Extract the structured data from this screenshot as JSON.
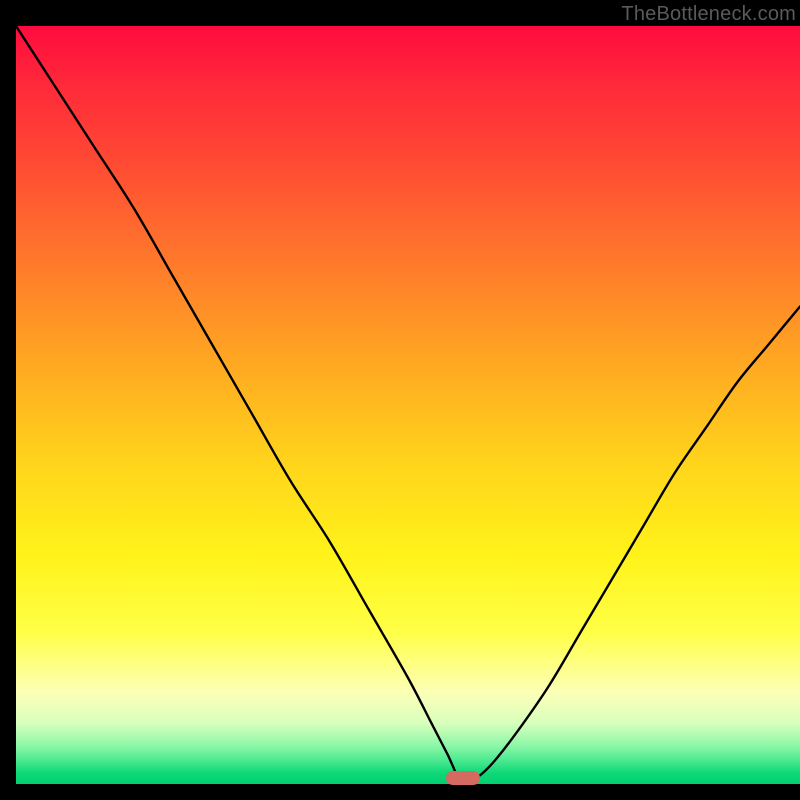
{
  "watermark": "TheBottleneck.com",
  "colors": {
    "frame": "#000000",
    "curve": "#000000",
    "marker": "#d46a60",
    "watermark": "#5a5a5a"
  },
  "chart_data": {
    "type": "line",
    "title": "",
    "xlabel": "",
    "ylabel": "",
    "xlim": [
      0,
      100
    ],
    "ylim": [
      0,
      100
    ],
    "grid": false,
    "legend": false,
    "annotations": [
      {
        "kind": "watermark",
        "text": "TheBottleneck.com",
        "position": "top-right"
      }
    ],
    "optimum": {
      "x": 57,
      "y": 0
    },
    "series": [
      {
        "name": "bottleneck-curve",
        "x": [
          0,
          5,
          10,
          15,
          20,
          25,
          30,
          35,
          40,
          45,
          50,
          53,
          55,
          57,
          59,
          61,
          64,
          68,
          72,
          76,
          80,
          84,
          88,
          92,
          96,
          100
        ],
        "y": [
          100,
          92,
          84,
          76,
          67,
          58,
          49,
          40,
          32,
          23,
          14,
          8,
          4,
          0,
          1,
          3,
          7,
          13,
          20,
          27,
          34,
          41,
          47,
          53,
          58,
          63
        ]
      }
    ]
  }
}
